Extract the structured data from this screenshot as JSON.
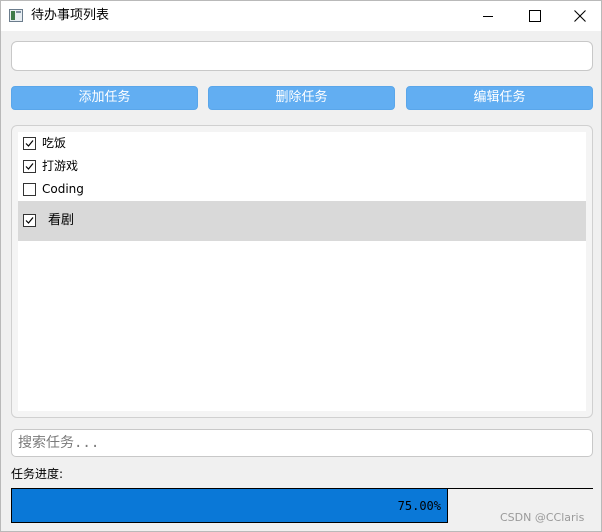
{
  "window": {
    "title": "待办事项列表"
  },
  "task_input": {
    "value": "",
    "placeholder": ""
  },
  "toolbar": {
    "add_label": "添加任务",
    "delete_label": "删除任务",
    "edit_label": "编辑任务",
    "button_color": "#62aef2"
  },
  "tasks": [
    {
      "label": "吃饭",
      "checked": true,
      "selected": false
    },
    {
      "label": "打游戏",
      "checked": true,
      "selected": false
    },
    {
      "label": "Coding",
      "checked": false,
      "selected": false
    },
    {
      "label": "看剧",
      "checked": true,
      "selected": true
    }
  ],
  "search": {
    "placeholder": "搜索任务..."
  },
  "progress": {
    "label": "任务进度:",
    "value_text": "75.00%",
    "fraction": 0.75,
    "fill_color": "#0a78d7"
  },
  "watermark": "CSDN @CClaris"
}
